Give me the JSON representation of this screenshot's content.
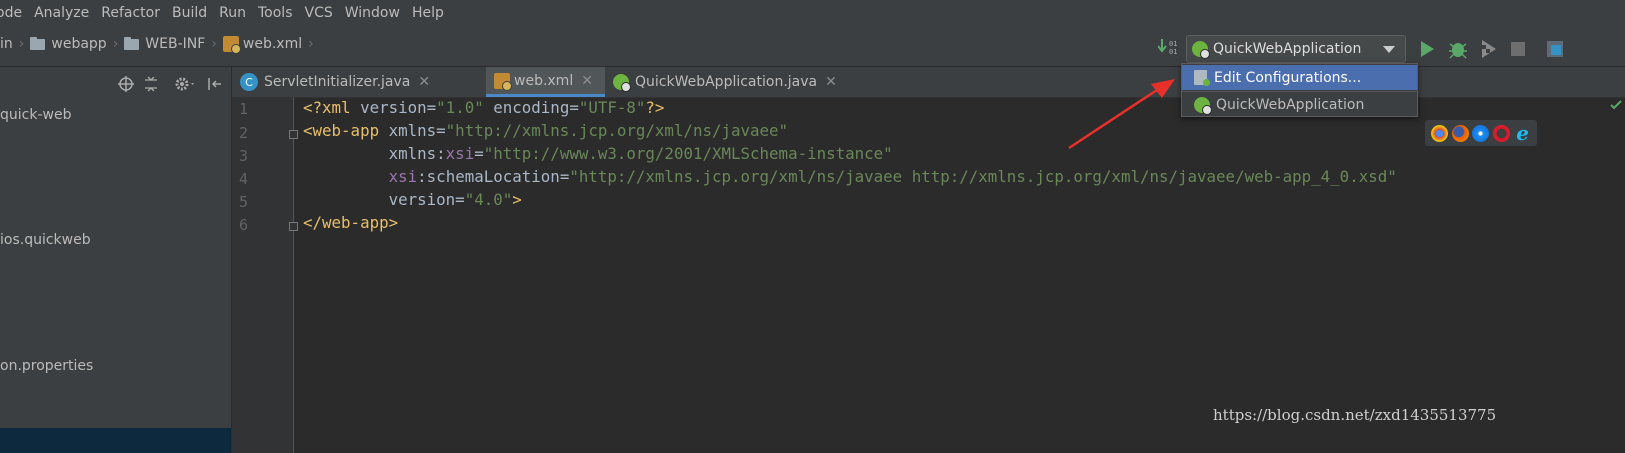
{
  "menu": {
    "items": [
      "Code",
      "Analyze",
      "Refactor",
      "Build",
      "Run",
      "Tools",
      "VCS",
      "Window",
      "Help"
    ],
    "first_item_visible": "ode"
  },
  "breadcrumbs": [
    "in",
    "webapp",
    "WEB-INF",
    "web.xml"
  ],
  "run_config": {
    "selected": "QuickWebApplication",
    "dropdown": [
      "Edit Configurations...",
      "QuickWebApplication"
    ]
  },
  "project_tree": {
    "items": [
      "quick-web",
      "ios.quickweb",
      "on.properties"
    ]
  },
  "tabs": [
    {
      "label": "ServletInitializer.java",
      "active": false
    },
    {
      "label": "web.xml",
      "active": true
    },
    {
      "label": "QuickWebApplication.java",
      "active": false
    }
  ],
  "editor": {
    "line_numbers": [
      "1",
      "2",
      "3",
      "4",
      "5",
      "6"
    ],
    "lines": [
      "<?xml version=\"1.0\" encoding=\"UTF-8\"?>",
      "<web-app xmlns=\"http://xmlns.jcp.org/xml/ns/javaee\"",
      "         xmlns:xsi=\"http://www.w3.org/2001/XMLSchema-instance\"",
      "         xsi:schemaLocation=\"http://xmlns.jcp.org/xml/ns/javaee http://xmlns.jcp.org/xml/ns/javaee/web-app_4_0.xsd\"",
      "         version=\"4.0\">",
      "</web-app>"
    ]
  },
  "browsers": [
    "chrome-icon",
    "firefox-icon",
    "safari-icon",
    "opera-icon",
    "ie-icon"
  ],
  "watermark": "https://blog.csdn.net/zxd1435513775",
  "colors": {
    "accent_selection": "#4b6eaf",
    "annotation_arrow": "#e8302b",
    "run_green": "#59a869",
    "spring_green": "#6db33f"
  }
}
